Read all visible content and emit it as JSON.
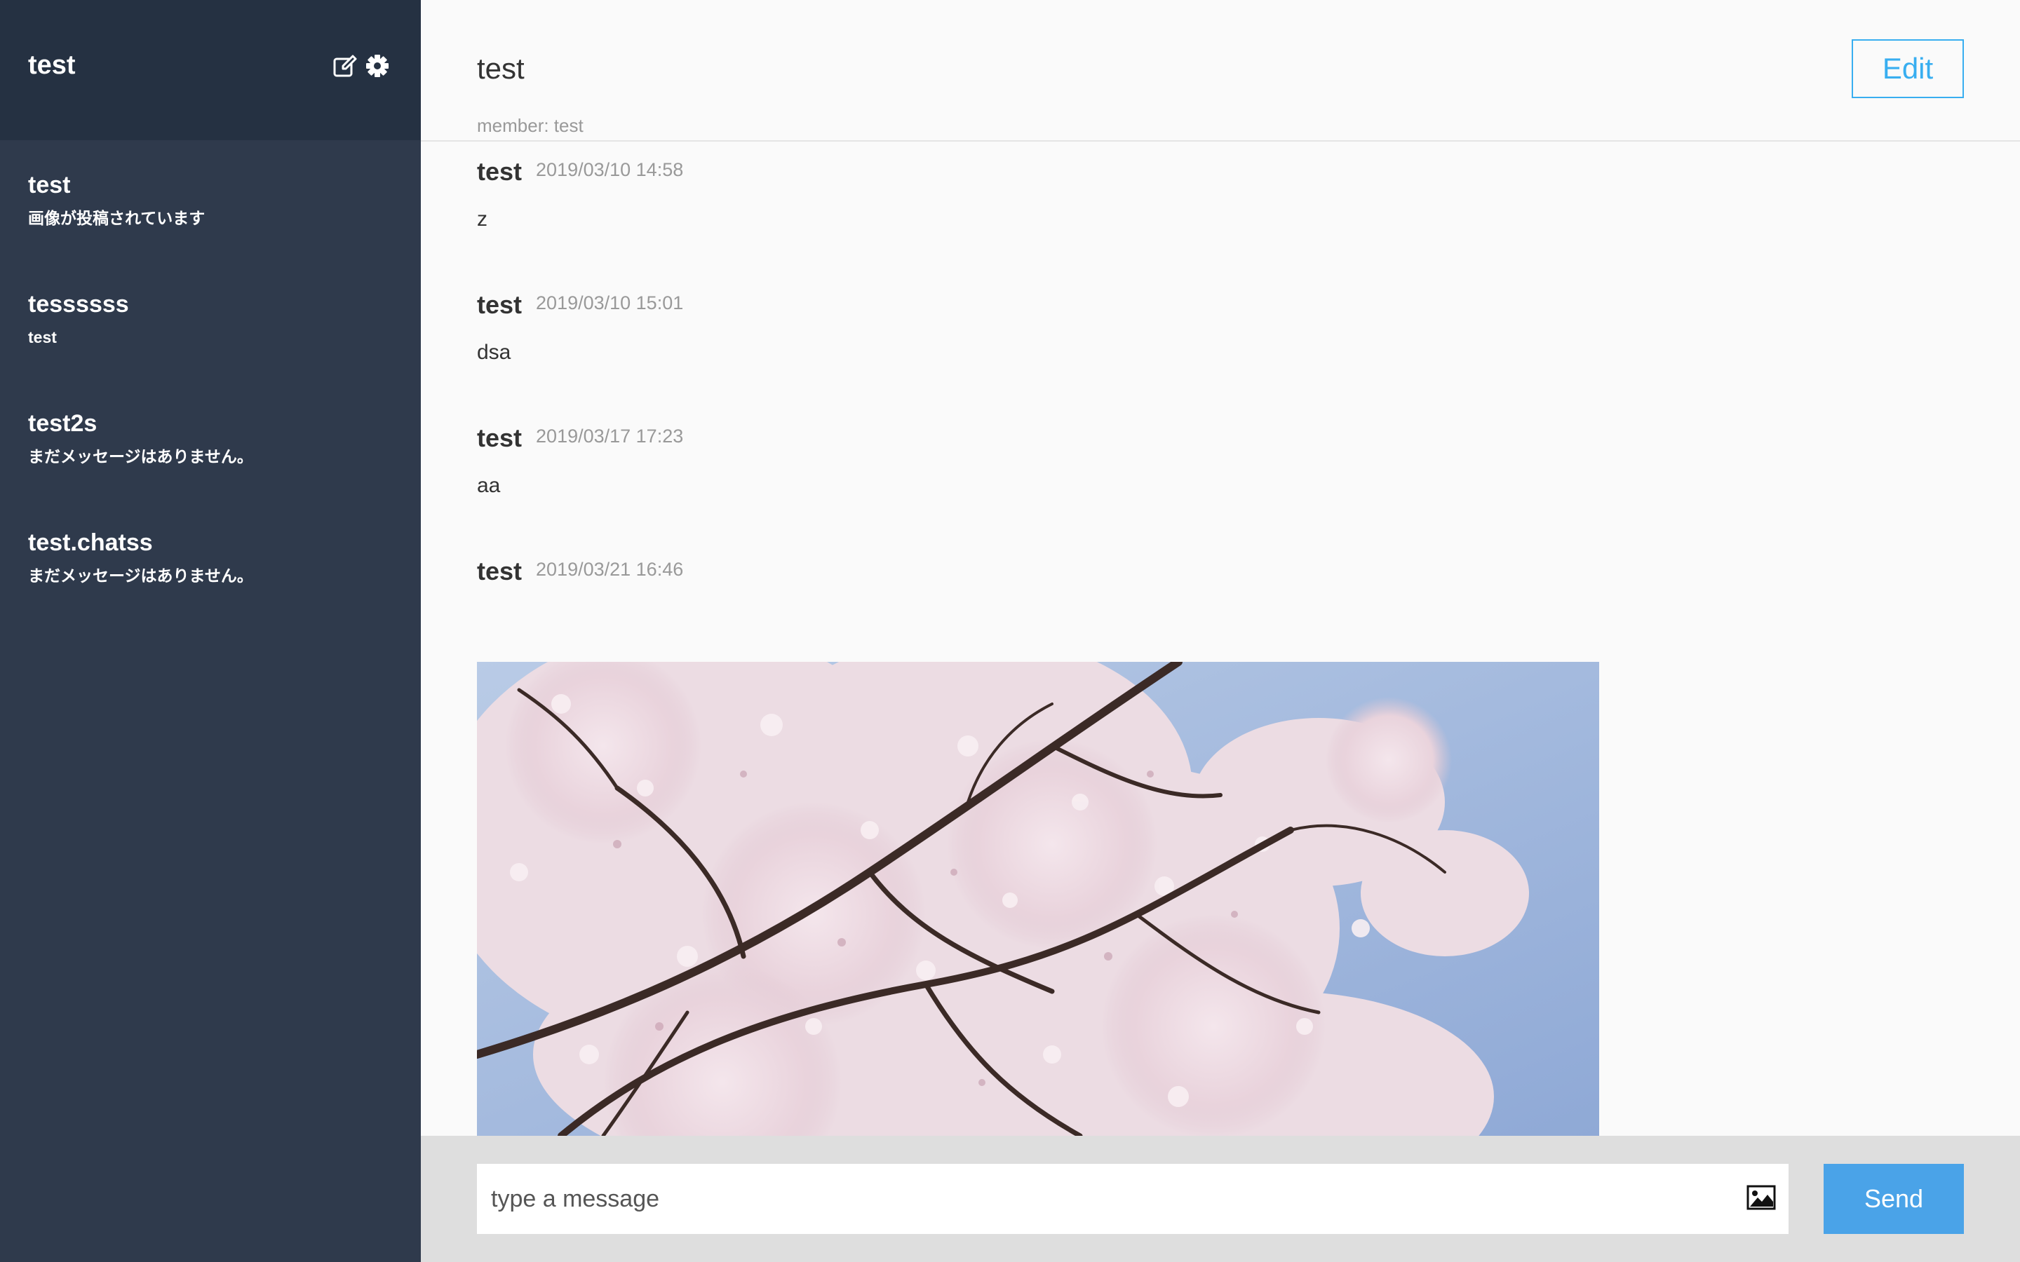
{
  "sidebar": {
    "user_name": "test",
    "icons": [
      "edit-icon",
      "gear-icon"
    ],
    "groups": [
      {
        "name": "test",
        "last_message": "画像が投稿されています"
      },
      {
        "name": "tessssss",
        "last_message": "test"
      },
      {
        "name": "test2s",
        "last_message": "まだメッセージはありません。"
      },
      {
        "name": "test.chatss",
        "last_message": "まだメッセージはありません。"
      }
    ]
  },
  "main": {
    "title": "test",
    "members": "member: test",
    "edit_label": "Edit",
    "messages": [
      {
        "user": "test",
        "date": "2019/03/10 14:58",
        "text": "z"
      },
      {
        "user": "test",
        "date": "2019/03/10 15:01",
        "text": "dsa"
      },
      {
        "user": "test",
        "date": "2019/03/17 17:23",
        "text": "aa"
      },
      {
        "user": "test",
        "date": "2019/03/21 16:46",
        "text": "",
        "image": "cherry-blossom-photo"
      }
    ]
  },
  "footer": {
    "placeholder": "type a message",
    "value": "",
    "send_label": "Send",
    "image_icon": "image-icon"
  },
  "colors": {
    "sidebar_bg": "#2f3a4c",
    "sidebar_header_bg": "#253142",
    "accent": "#38aef0",
    "send_bg": "#4aa3e8",
    "footer_bg": "#dedede"
  }
}
